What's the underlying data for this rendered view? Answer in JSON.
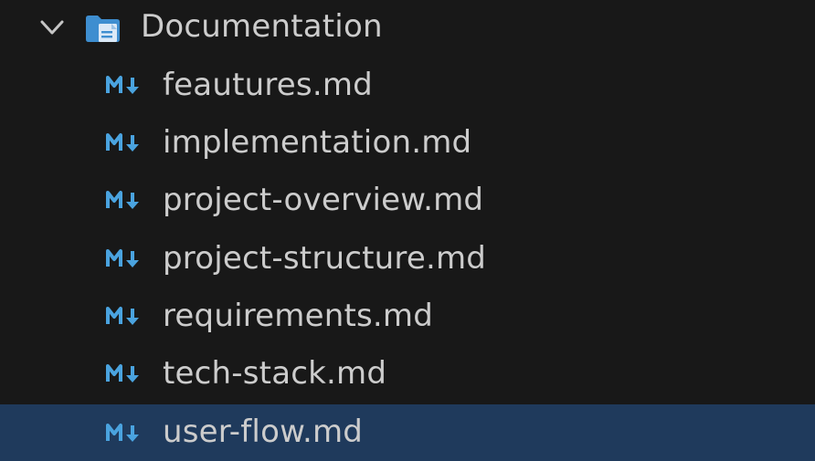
{
  "explorer": {
    "folder": {
      "label": "Documentation",
      "expanded": true,
      "icon": "folder-docs-icon",
      "icon_color": "#3e8ed0"
    },
    "files": [
      {
        "label": "feautures.md",
        "icon": "markdown-icon",
        "selected": false
      },
      {
        "label": "implementation.md",
        "icon": "markdown-icon",
        "selected": false
      },
      {
        "label": "project-overview.md",
        "icon": "markdown-icon",
        "selected": false
      },
      {
        "label": "project-structure.md",
        "icon": "markdown-icon",
        "selected": false
      },
      {
        "label": "requirements.md",
        "icon": "markdown-icon",
        "selected": false
      },
      {
        "label": "tech-stack.md",
        "icon": "markdown-icon",
        "selected": false
      },
      {
        "label": "user-flow.md",
        "icon": "markdown-icon",
        "selected": true
      }
    ],
    "colors": {
      "background": "#181818",
      "selected_background": "#1f3a5c",
      "text": "#cccccc",
      "markdown_icon": "#4aa3df"
    }
  }
}
